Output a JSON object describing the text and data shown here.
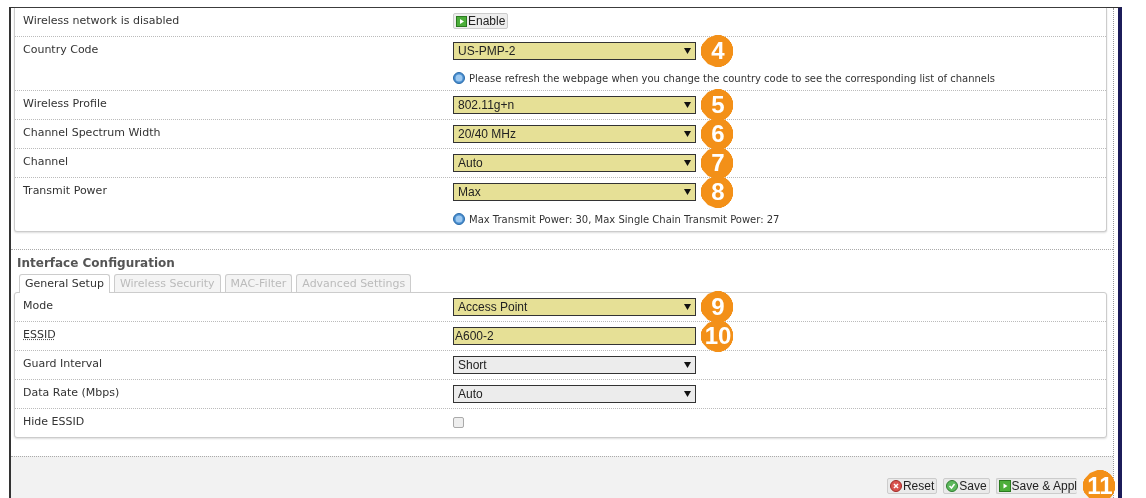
{
  "device_section": {
    "rows": [
      {
        "label": "Wireless network is disabled",
        "kind": "button",
        "value": "Enable"
      },
      {
        "label": "Country Code",
        "kind": "select",
        "value": "US-PMP-2",
        "highlighted": true,
        "callout": "4",
        "note": "Please refresh the webpage when you change the country code to see the corresponding list of channels"
      },
      {
        "label": "Wireless Profile",
        "kind": "select",
        "value": "802.11g+n",
        "highlighted": true,
        "callout": "5"
      },
      {
        "label": "Channel Spectrum Width",
        "kind": "select",
        "value": "20/40 MHz",
        "highlighted": true,
        "callout": "6"
      },
      {
        "label": "Channel",
        "kind": "select",
        "value": "Auto",
        "highlighted": true,
        "callout": "7"
      },
      {
        "label": "Transmit Power",
        "kind": "select",
        "value": "Max",
        "highlighted": true,
        "callout": "8",
        "note": "Max Transmit Power: 30, Max Single Chain Transmit Power: 27"
      }
    ]
  },
  "interface_section": {
    "title": "Interface Configuration",
    "tabs": [
      {
        "label": "General Setup",
        "selected": true
      },
      {
        "label": "Wireless Security",
        "selected": false
      },
      {
        "label": "MAC-Filter",
        "selected": false
      },
      {
        "label": "Advanced Settings",
        "selected": false
      }
    ],
    "rows": [
      {
        "label": "Mode",
        "kind": "select",
        "value": "Access Point",
        "highlighted": true,
        "callout": "9"
      },
      {
        "label": "ESSID",
        "kind": "text",
        "value": "A600-2",
        "highlighted": true,
        "callout": "10",
        "abbr": true
      },
      {
        "label": "Guard Interval",
        "kind": "select",
        "value": "Short",
        "highlighted": false
      },
      {
        "label": "Data Rate (Mbps)",
        "kind": "select",
        "value": "Auto",
        "highlighted": false
      },
      {
        "label": "Hide ESSID",
        "kind": "checkbox",
        "checked": false
      }
    ]
  },
  "footer_buttons": [
    {
      "label": "Reset",
      "kind": "reset"
    },
    {
      "label": "Save",
      "kind": "save"
    },
    {
      "label": "Save & Appl",
      "kind": "apply",
      "callout": "11"
    }
  ]
}
